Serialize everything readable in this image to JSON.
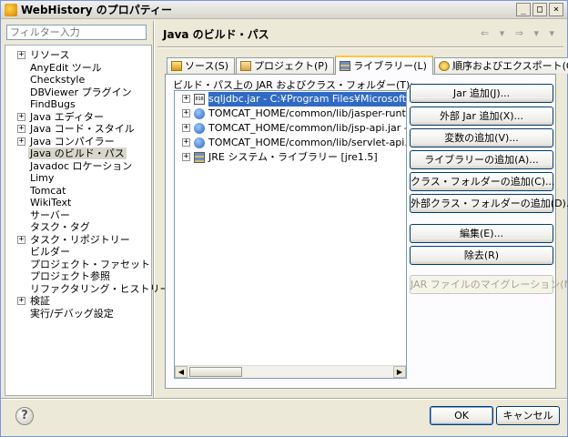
{
  "window": {
    "title": "WebHistory のプロパティー",
    "controls": [
      "_",
      "□",
      "×"
    ]
  },
  "left": {
    "filter_placeholder": "フィルター入力",
    "nav_items": [
      {
        "label": "リソース",
        "expander": "+"
      },
      {
        "label": "AnyEdit ツール",
        "expander": ""
      },
      {
        "label": "Checkstyle",
        "expander": ""
      },
      {
        "label": "DBViewer プラグイン",
        "expander": ""
      },
      {
        "label": "FindBugs",
        "expander": ""
      },
      {
        "label": "Java エディター",
        "expander": "+"
      },
      {
        "label": "Java コード・スタイル",
        "expander": "+"
      },
      {
        "label": "Java コンパイラー",
        "expander": "+"
      },
      {
        "label": "Java のビルド・パス",
        "expander": "",
        "selected": true
      },
      {
        "label": "Javadoc ロケーション",
        "expander": ""
      },
      {
        "label": "Limy",
        "expander": ""
      },
      {
        "label": "Tomcat",
        "expander": ""
      },
      {
        "label": "WikiText",
        "expander": ""
      },
      {
        "label": "サーバー",
        "expander": ""
      },
      {
        "label": "タスク・タグ",
        "expander": ""
      },
      {
        "label": "タスク・リポジトリー",
        "expander": "+"
      },
      {
        "label": "ビルダー",
        "expander": ""
      },
      {
        "label": "プロジェクト・ファセット",
        "expander": ""
      },
      {
        "label": "プロジェクト参照",
        "expander": ""
      },
      {
        "label": "リファクタリング・ヒストリー",
        "expander": ""
      },
      {
        "label": "検証",
        "expander": "+"
      },
      {
        "label": "実行/デバッグ設定",
        "expander": ""
      }
    ]
  },
  "right": {
    "page_title": "Java のビルド・パス",
    "nav_arrows": "⇐ ▾ ⇒ ▾ ▾",
    "tabs": [
      {
        "label": "ソース(S)",
        "icon": "source-folder-icon"
      },
      {
        "label": "プロジェクト(P)",
        "icon": "project-icon"
      },
      {
        "label": "ライブラリー(L)",
        "icon": "library-icon",
        "active": true
      },
      {
        "label": "順序およびエクスポート(O)",
        "icon": "order-export-icon"
      }
    ],
    "build_path_label": "ビルド・パス上の JAR およびクラス・フォルダー(T):",
    "libraries": [
      {
        "text": "sqljdbc.jar - C:¥Program Files¥Microsoft SQL S",
        "icon": "jar-icon",
        "selected": true
      },
      {
        "text": "TOMCAT_HOME/common/lib/jasper-runtime.ja",
        "icon": "variable-icon"
      },
      {
        "text": "TOMCAT_HOME/common/lib/jsp-api.jar - D:¥",
        "icon": "variable-icon"
      },
      {
        "text": "TOMCAT_HOME/common/lib/servlet-api.jar -",
        "icon": "variable-icon"
      },
      {
        "text": "JRE システム・ライブラリー [jre1.5]",
        "icon": "jre-library-icon"
      }
    ],
    "jar_icon_text": "010",
    "buttons": [
      {
        "label": "Jar 追加(J)...",
        "enabled": true
      },
      {
        "label": "外部 Jar 追加(X)...",
        "enabled": true
      },
      {
        "label": "変数の追加(V)...",
        "enabled": true
      },
      {
        "label": "ライブラリーの追加(A)...",
        "enabled": true
      },
      {
        "label": "クラス・フォルダーの追加(C)...",
        "enabled": true
      },
      {
        "label": "外部クラス・フォルダーの追加(D)...",
        "enabled": true
      },
      {
        "label": "編集(E)...",
        "enabled": true
      },
      {
        "label": "除去(R)",
        "enabled": true
      },
      {
        "label": "JAR ファイルのマイグレーション(M)...",
        "enabled": false
      }
    ]
  },
  "footer": {
    "help": "?",
    "ok": "OK",
    "cancel": "キャンセル"
  }
}
